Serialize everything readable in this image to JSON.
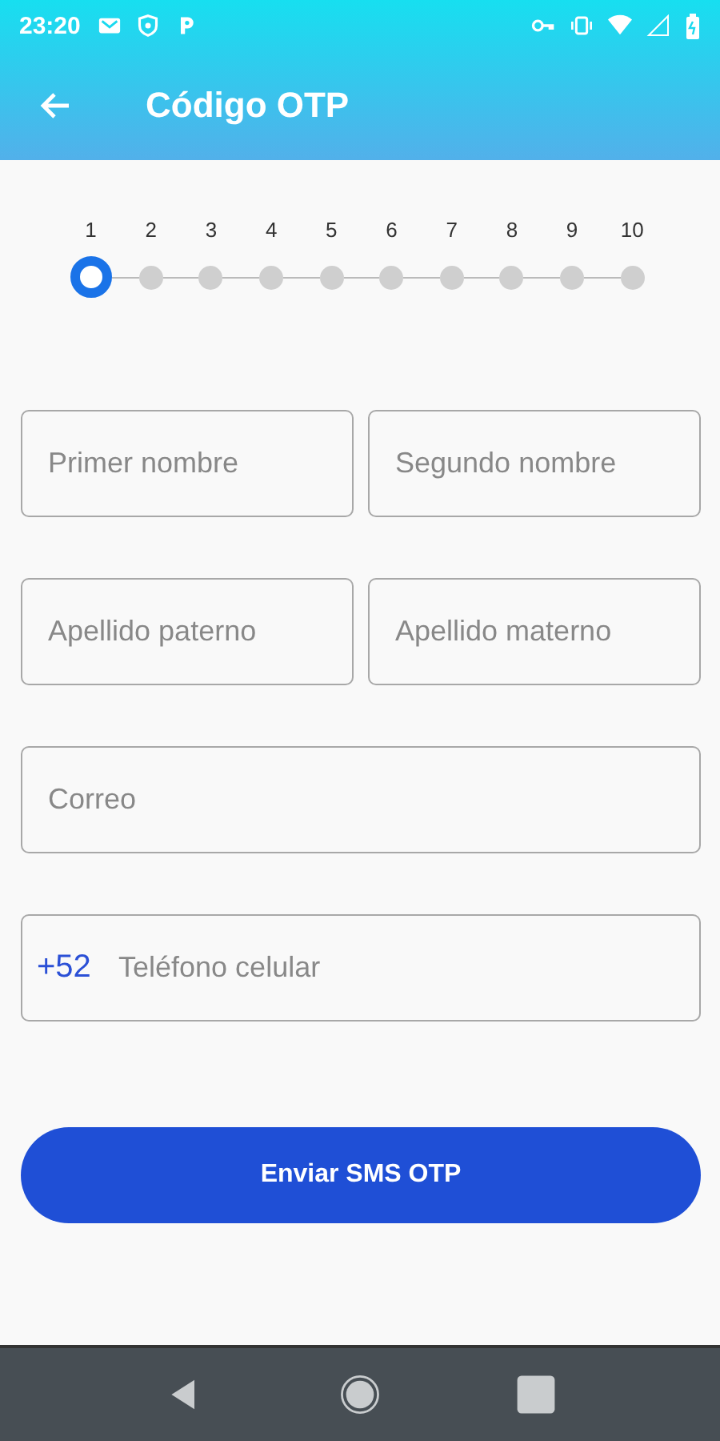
{
  "status_bar": {
    "time": "23:20"
  },
  "app_bar": {
    "title": "Código OTP"
  },
  "steps": [
    {
      "label": "1",
      "selected": true
    },
    {
      "label": "2",
      "selected": false
    },
    {
      "label": "3",
      "selected": false
    },
    {
      "label": "4",
      "selected": false
    },
    {
      "label": "5",
      "selected": false
    },
    {
      "label": "6",
      "selected": false
    },
    {
      "label": "7",
      "selected": false
    },
    {
      "label": "8",
      "selected": false
    },
    {
      "label": "9",
      "selected": false
    },
    {
      "label": "10",
      "selected": false
    }
  ],
  "form_rows": [
    {
      "fields": [
        {
          "placeholder": "Primer nombre"
        },
        {
          "placeholder": "Segundo nombre"
        }
      ]
    },
    {
      "fields": [
        {
          "placeholder": "Apellido paterno"
        },
        {
          "placeholder": "Apellido materno"
        }
      ]
    },
    {
      "fields": [
        {
          "placeholder": "Correo"
        }
      ]
    },
    {
      "fields": [
        {
          "prefix": "+52",
          "placeholder": "Teléfono celular"
        }
      ]
    }
  ],
  "submit_button": {
    "label": "Enviar SMS OTP"
  }
}
